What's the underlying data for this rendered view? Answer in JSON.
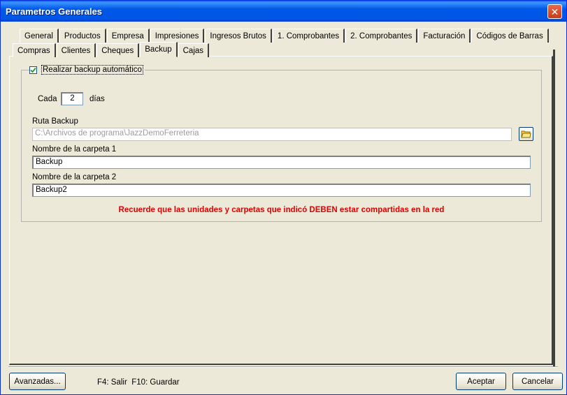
{
  "window": {
    "title": "Parametros Generales"
  },
  "tabs_top": [
    "General",
    "Productos",
    "Empresa",
    "Impresiones",
    "Ingresos Brutos",
    "1. Comprobantes",
    "2. Comprobantes",
    "Facturación",
    "Códigos de Barras"
  ],
  "tabs_bottom": [
    "Compras",
    "Clientes",
    "Cheques",
    "Backup",
    "Cajas"
  ],
  "active_tab": "Backup",
  "backup": {
    "auto_label": "Realizar backup automático",
    "auto_checked": true,
    "cada_label": "Cada",
    "dias_value": "2",
    "dias_label": "días",
    "ruta_label": "Ruta Backup",
    "ruta_value": "C:\\Archivos de programa\\JazzDemoFerreteria",
    "carpeta1_label": "Nombre de la carpeta 1",
    "carpeta1_value": "Backup",
    "carpeta2_label": "Nombre de la carpeta 2",
    "carpeta2_value": "Backup2",
    "warning": "Recuerde que las unidades y carpetas que indicó DEBEN estar compartidas en la red"
  },
  "footer": {
    "advanced_label": "Avanzadas...",
    "shortcuts": "F4: Salir  F10: Guardar",
    "accept_label": "Aceptar",
    "cancel_label": "Cancelar"
  },
  "colors": {
    "titlebar": "#0058e6",
    "warning": "#e00000",
    "face": "#ece9d8"
  }
}
